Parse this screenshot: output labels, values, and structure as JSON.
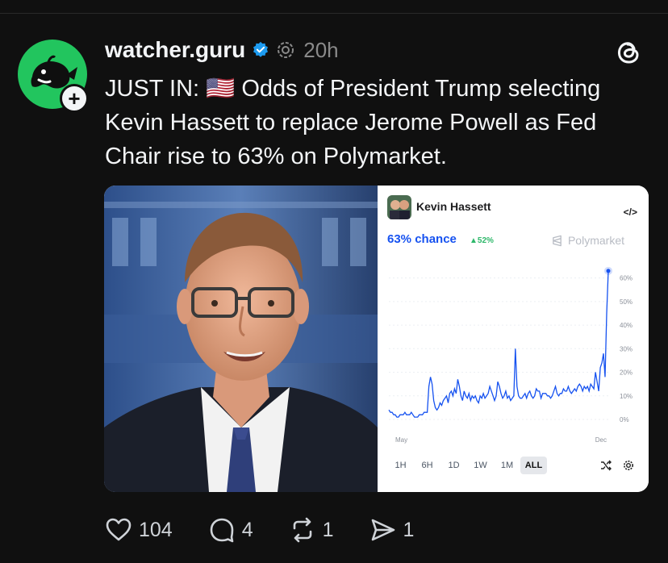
{
  "post": {
    "username": "watcher.guru",
    "timestamp": "20h",
    "text": "JUST IN: 🇺🇸 Odds of President Trump selecting Kevin Hassett to replace Jerome Powell as Fed Chair rise to 63% on Polymarket."
  },
  "card": {
    "title": "Kevin Hassett",
    "embed_label": "</>",
    "chance": "63% chance",
    "delta": "▲52%",
    "brand": "Polymarket",
    "range_buttons": [
      "1H",
      "6H",
      "1D",
      "1W",
      "1M",
      "ALL"
    ],
    "selected_range": "ALL"
  },
  "chart_data": {
    "type": "line",
    "x_tick_labels": [
      "May",
      "Dec"
    ],
    "y_tick_labels": [
      "60%",
      "50%",
      "40%",
      "30%",
      "20%",
      "10%",
      "0%"
    ],
    "ylim": [
      0,
      65
    ],
    "series": [
      {
        "values": [
          4,
          3,
          3,
          2,
          2,
          1,
          1,
          2,
          2,
          2,
          3,
          2,
          2,
          2,
          3,
          2,
          1,
          1,
          1,
          2,
          2,
          2,
          3,
          3,
          3,
          14,
          18,
          15,
          8,
          5,
          4,
          5,
          7,
          6,
          8,
          9,
          10,
          7,
          11,
          12,
          10,
          13,
          11,
          17,
          14,
          10,
          8,
          12,
          10,
          9,
          11,
          8,
          10,
          9,
          10,
          8,
          7,
          10,
          9,
          11,
          9,
          10,
          11,
          14,
          12,
          10,
          8,
          10,
          16,
          14,
          11,
          9,
          10,
          12,
          9,
          10,
          8,
          9,
          10,
          30,
          14,
          10,
          9,
          9,
          10,
          11,
          9,
          11,
          12,
          10,
          9,
          10,
          13,
          12,
          12,
          9,
          11,
          11,
          11,
          10,
          10,
          9,
          10,
          12,
          14,
          11,
          10,
          11,
          11,
          13,
          12,
          12,
          14,
          12,
          11,
          12,
          13,
          12,
          14,
          15,
          14,
          12,
          14,
          13,
          14,
          12,
          15,
          14,
          13,
          20,
          16,
          12,
          22,
          24,
          28,
          18,
          45,
          63
        ]
      }
    ],
    "colors": {
      "line": "#1652f0",
      "chance": "#1652f0",
      "delta": "#2eb86a"
    }
  },
  "actions": {
    "likes": "104",
    "replies": "4",
    "reposts": "1",
    "shares": "1"
  }
}
